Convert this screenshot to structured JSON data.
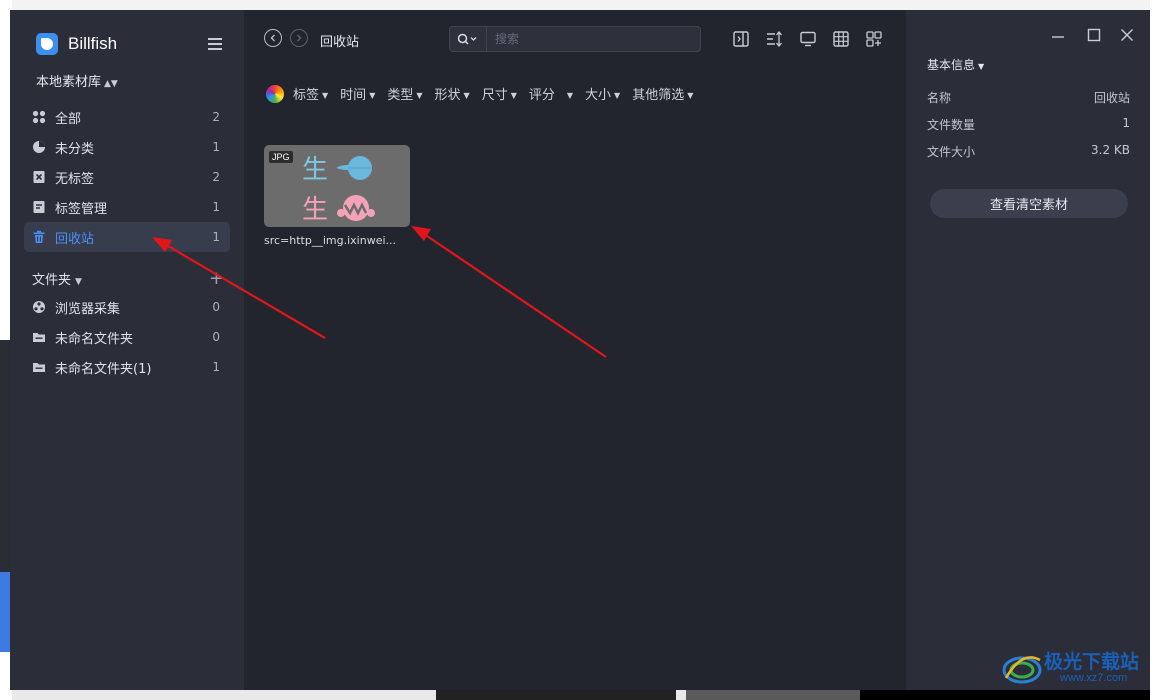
{
  "app": {
    "name": "Billfish",
    "library": "本地素材库"
  },
  "sidebar": {
    "items": [
      {
        "label": "全部",
        "count": "2",
        "icon": "grid-icon"
      },
      {
        "label": "未分类",
        "count": "1",
        "icon": "pie-icon"
      },
      {
        "label": "无标签",
        "count": "2",
        "icon": "tag-off-icon"
      },
      {
        "label": "标签管理",
        "count": "1",
        "icon": "tag-manage-icon"
      },
      {
        "label": "回收站",
        "count": "1",
        "icon": "trash-icon",
        "active": true
      }
    ],
    "folders_title": "文件夹",
    "folders": [
      {
        "label": "浏览器采集",
        "count": "0",
        "icon": "browser-collect-icon"
      },
      {
        "label": "未命名文件夹",
        "count": "0",
        "icon": "folder-icon"
      },
      {
        "label": "未命名文件夹(1)",
        "count": "1",
        "icon": "folder-icon"
      }
    ]
  },
  "toolbar": {
    "title": "回收站",
    "search_placeholder": "搜索"
  },
  "filters": [
    "标签",
    "时间",
    "类型",
    "形状",
    "尺寸",
    "评分",
    "大小",
    "其他筛选"
  ],
  "items": [
    {
      "badge": "JPG",
      "name": "src=http__img.ixinwei...",
      "glyphs": [
        "生",
        "生"
      ]
    }
  ],
  "panel": {
    "title": "基本信息",
    "rows": [
      {
        "key": "名称",
        "value": "回收站"
      },
      {
        "key": "文件数量",
        "value": "1"
      },
      {
        "key": "文件大小",
        "value": "3.2 KB"
      }
    ],
    "empty_button": "查看清空素材"
  },
  "watermark": {
    "line1": "极光下载站",
    "line2": "www.xz7.com"
  },
  "colors": {
    "accent": "#4a8ff7",
    "sidebar_bg": "#2b2e39",
    "main_bg": "#23252e",
    "arrow": "#e0161b"
  }
}
